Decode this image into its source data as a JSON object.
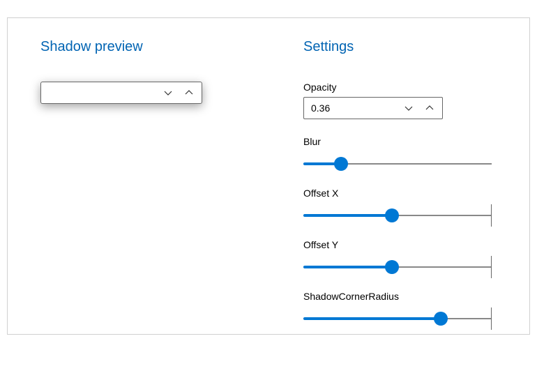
{
  "preview": {
    "title": "Shadow preview"
  },
  "settings": {
    "title": "Settings",
    "opacity": {
      "label": "Opacity",
      "value": "0.36"
    },
    "blur": {
      "label": "Blur",
      "percent": 20,
      "show_end_tick": false
    },
    "offset_x": {
      "label": "Offset X",
      "percent": 47,
      "show_end_tick": true
    },
    "offset_y": {
      "label": "Offset Y",
      "percent": 47,
      "show_end_tick": true
    },
    "corner_radius": {
      "label": "ShadowCornerRadius",
      "percent": 73,
      "show_end_tick": true
    }
  },
  "colors": {
    "accent": "#0078d4",
    "heading": "#0164b3"
  }
}
